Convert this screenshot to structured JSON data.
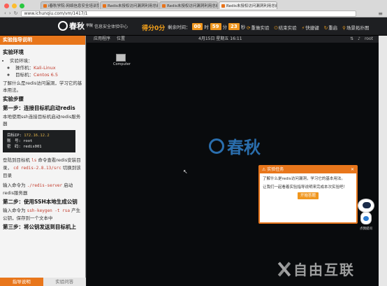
{
  "browser": {
    "tabs": [
      {
        "label": "i春秋学院-网络信息安全培训第一品牌"
      },
      {
        "label": "Redis未授权访问漏洞利用总结"
      },
      {
        "label": "Redis未授权访问漏洞利用总结"
      },
      {
        "label": "Redis未授权访问漏洞利用总结"
      }
    ],
    "url": "www.ichunqiu.com/vm/1417/1"
  },
  "topbar": {
    "logo": "春秋",
    "logo_sub": "学院",
    "tagline": "信息安全体验中心",
    "score": "得分0分",
    "timer_label": "剩余时间：",
    "timer": {
      "h": "00",
      "h_unit": "时",
      "m": "59",
      "m_unit": "分",
      "s": "23",
      "s_unit": "秒"
    },
    "actions": [
      "重做实验",
      "结束实验",
      "快捷键",
      "重启",
      "场景拓扑图"
    ]
  },
  "left": {
    "header": "实验指导说明",
    "env_title": "实验环境",
    "env_item": "实验环境：",
    "attacker_label": "操作机：",
    "attacker_value": "Kali-Linux",
    "target_label": "目标机：",
    "target_value": "Centos 6.5",
    "intro": "了解什么是redis访问漏洞，学习它的基本用法。",
    "steps_title": "实验步骤",
    "step1_title": "第一步：连接目标机启动redis",
    "step1_text": "本地使用ssh连接目标机启动redis服务器",
    "code": {
      "ip_label": "目标IP:",
      "ip": "172.16.12.2",
      "user_label": "账　号:",
      "user": "root",
      "pass_label": "密　码:",
      "pass": "redis001"
    },
    "p1a": "登陆到目标机",
    "p1b": "ls",
    "p1c": "命令查看redis安装目录，",
    "p1d": "cd redis-2.8.13/src",
    "p1e": "切换到该目录",
    "p2a": "输入命令为",
    "p2b": "./redis-server",
    "p2c": "启动redis服务器",
    "step2_title": "第二步：使用SSH本地生成公钥",
    "p3a": "输入命令为",
    "p3b": "ssh-keygen -t rsa",
    "p3c": "产生公钥，保存到一个文本中",
    "step3_title": "第三步：将公钥发送到目标机上",
    "tab_guide": "指导说明",
    "tab_qa": "实验问答"
  },
  "desktop": {
    "menu": [
      "应用程序",
      "位置"
    ],
    "clock": "4月15日 星期五 16:11",
    "user": "root",
    "icon_label": "Computer",
    "brand": "春秋"
  },
  "dialog": {
    "title": "实验任务",
    "body1": "了解什么是redis访问漏洞，学习它的基本用法。",
    "body2": "让我们一起看着实验指导说明来完成本次实验吧！",
    "start": "开始答题"
  },
  "robot": {
    "label": "点我提问"
  },
  "watermark": {
    "text": "自由互联"
  },
  "colors": {
    "accent": "#e8761b",
    "timer": "#f0961e",
    "brand_blue": "#2a6ead"
  }
}
